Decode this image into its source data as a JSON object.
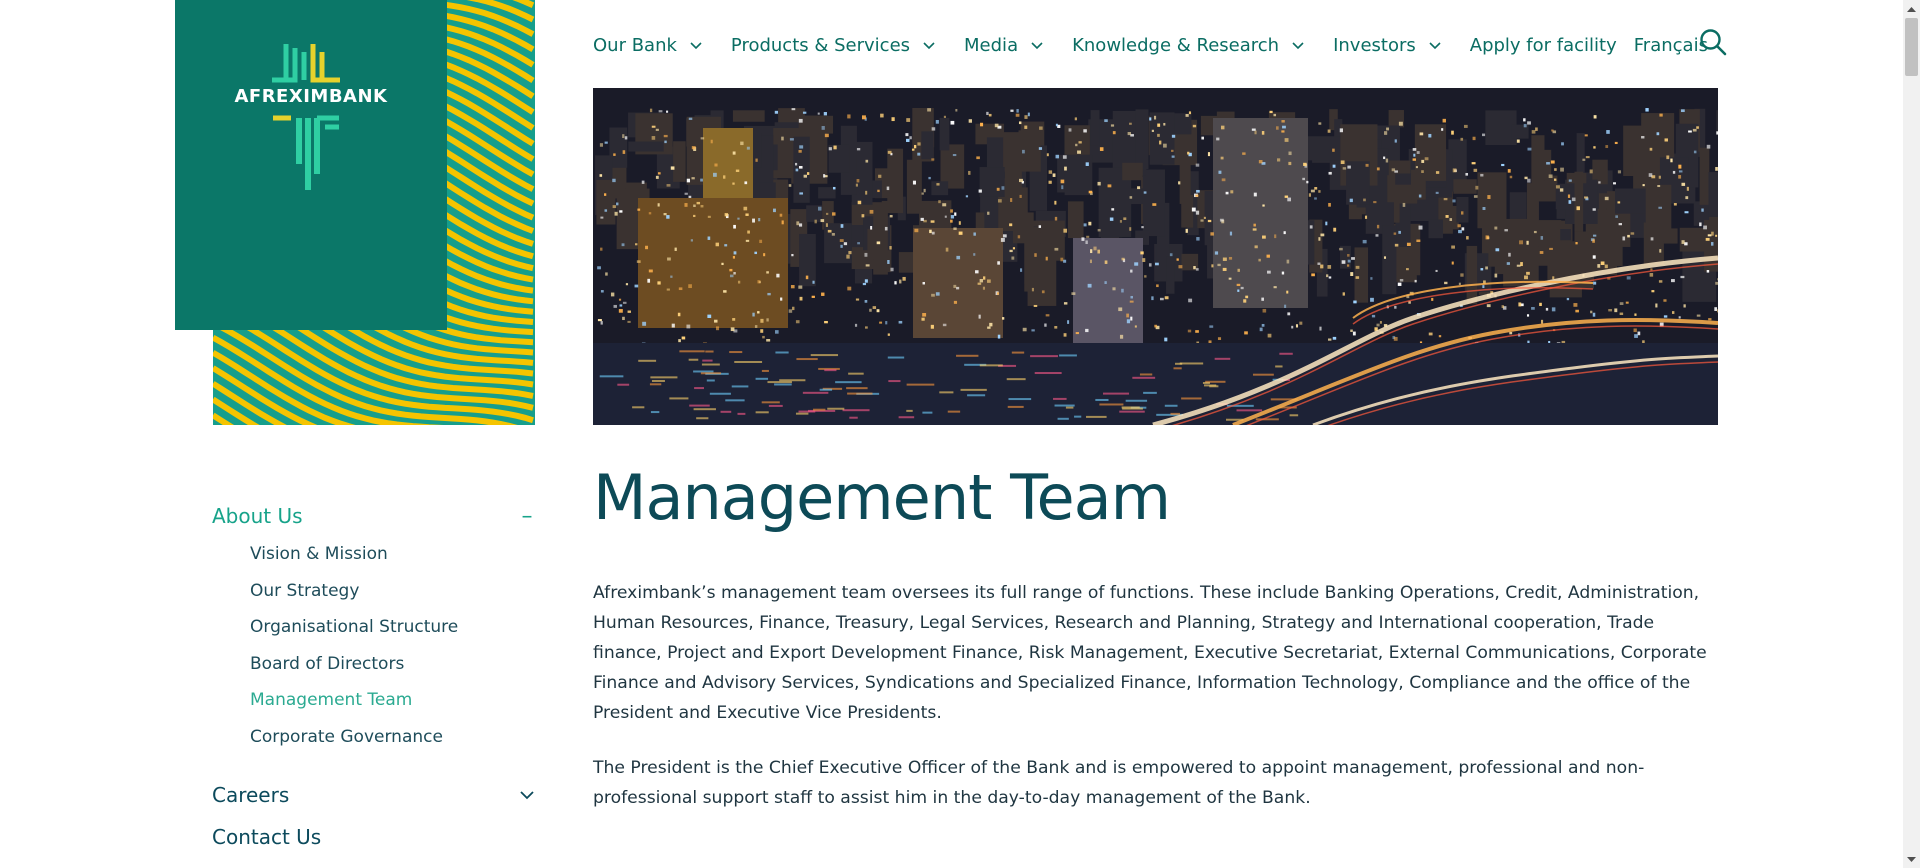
{
  "logo": {
    "text": "AFREXIMBANK"
  },
  "nav": {
    "items": [
      {
        "label": "Our Bank",
        "dropdown": true
      },
      {
        "label": "Products & Services",
        "dropdown": true
      },
      {
        "label": "Media",
        "dropdown": true
      },
      {
        "label": "Knowledge & Research",
        "dropdown": true
      },
      {
        "label": "Investors",
        "dropdown": true
      },
      {
        "label": "Apply for facility",
        "dropdown": false
      },
      {
        "label": "Français",
        "dropdown": false
      }
    ],
    "search_icon": "search-icon"
  },
  "sidebar": {
    "about": {
      "label": "About Us",
      "toggle": "–"
    },
    "about_items": [
      {
        "label": "Vision & Mission"
      },
      {
        "label": "Our Strategy"
      },
      {
        "label": "Organisational Structure"
      },
      {
        "label": "Board of Directors"
      },
      {
        "label": "Management Team",
        "active": true
      },
      {
        "label": "Corporate Governance"
      }
    ],
    "careers": {
      "label": "Careers"
    },
    "contact": {
      "label": "Contact Us"
    }
  },
  "main": {
    "title": "Management Team",
    "paragraphs": [
      "Afreximbank’s management team oversees its full range of functions. These include Banking Operations, Credit, Administration, Human Resources, Finance, Treasury, Legal Services, Research and Planning, Strategy and International cooperation, Trade finance, Project and Export Development Finance, Risk Management, Executive Secretariat, External Communications, Corporate Finance and Advisory Services, Syndications and Specialized Finance, Information Technology, Compliance and the office of the President and Executive Vice Presidents.",
      "The President is the Chief Executive Officer of the Bank and is empowered to appoint management, professional and non-professional support staff to assist him in the day-to-day management of the Bank."
    ]
  },
  "colors": {
    "brand_dark_green": "#0b7768",
    "brand_teal": "#169e8c",
    "brand_yellow": "#f5c400",
    "nav_text": "#0b6d63",
    "accent_active": "#2baa91"
  }
}
